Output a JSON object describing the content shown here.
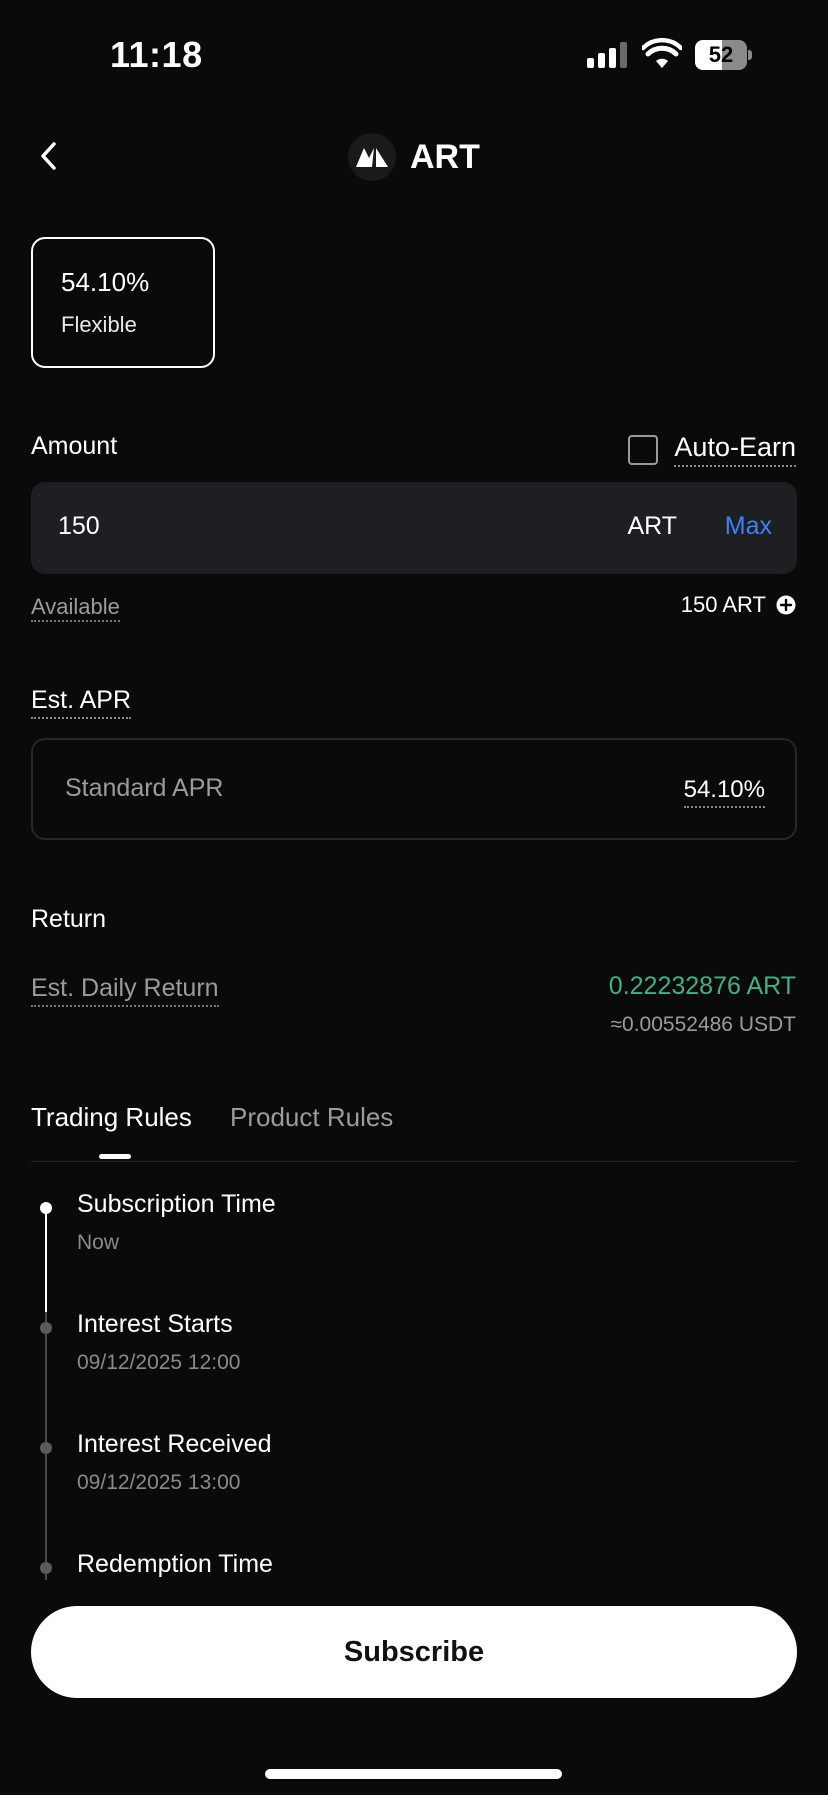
{
  "status_bar": {
    "time": "11:18",
    "battery": "52",
    "battery_level": 0.52
  },
  "header": {
    "title": "ART",
    "logo_icon": "art-token-logo"
  },
  "apr_card": {
    "percent": "54.10%",
    "type": "Flexible"
  },
  "amount": {
    "label": "Amount",
    "auto_earn_label": "Auto-Earn",
    "auto_earn_checked": false,
    "value": "150",
    "unit": "ART",
    "max_label": "Max",
    "available_label": "Available",
    "available_value": "150 ART"
  },
  "est_apr": {
    "label": "Est. APR",
    "standard_label": "Standard APR",
    "standard_value": "54.10%"
  },
  "return": {
    "label": "Return",
    "daily_label": "Est. Daily Return",
    "daily_value": "0.22232876 ART",
    "daily_usdt": "≈0.00552486 USDT"
  },
  "tabs": [
    {
      "label": "Trading Rules",
      "active": true
    },
    {
      "label": "Product Rules",
      "active": false
    }
  ],
  "timeline": [
    {
      "title": "Subscription Time",
      "sub": "Now"
    },
    {
      "title": "Interest Starts",
      "sub": "09/12/2025 12:00"
    },
    {
      "title": "Interest Received",
      "sub": "09/12/2025 13:00"
    },
    {
      "title": "Redemption Time",
      "sub": ""
    }
  ],
  "subscribe_label": "Subscribe",
  "colors": {
    "accent_blue": "#3b82f6",
    "return_green": "#3fb27f",
    "background": "#0a0a0b"
  }
}
